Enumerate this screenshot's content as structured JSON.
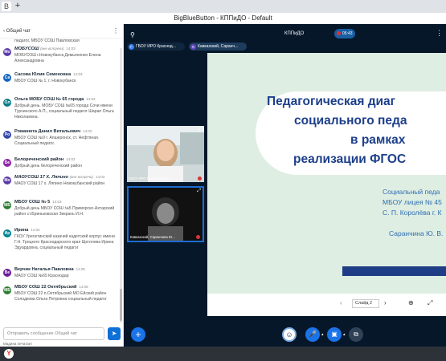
{
  "browser": {
    "tab_icon": "B",
    "new_tab": "+",
    "window_title": "BigBlueButton - КППиДО - Default"
  },
  "chat": {
    "back": "‹",
    "title": "Общий чат",
    "more": "⋮",
    "first_line": "педагог, МБОУ СОШ Павловская",
    "composer_placeholder": "Отправить сообщение Общий чат",
    "send": "➤",
    "typing": "Мадина печатает",
    "messages": [
      {
        "initials": "Мо",
        "color": "#5b3aa8",
        "name": "МОБУСОШ",
        "status": "(вне встречи)",
        "time": "14:03",
        "text": "МОБУСОШ г.Новокубанск,Демьяненко Елена Александровна",
        "italic": true
      },
      {
        "initials": "Са",
        "color": "#1565c0",
        "name": "Сасова Юлия Семеновна",
        "status": "",
        "time": "14:03",
        "text": "МБОУ СОШ № 1, г. Новокубанск",
        "italic": false
      },
      {
        "initials": "Ол",
        "color": "#0d7d8a",
        "name": "Ольга МОБУ СОШ № 65 города",
        "status": "",
        "time": "14:03",
        "text": "Добрый день. МОБУ СОШ №65 города Сочи имени Турчинского А.П., социальный педагог Шарап Ольга Николаевна.",
        "italic": false
      },
      {
        "initials": "Ро",
        "color": "#3949ab",
        "name": "Романюта Данил Витальевич",
        "status": "",
        "time": "14:02",
        "text": "МБОУ СОШ №9 г. Апшеронск, ст. Нефтяная. Социальный педагог.",
        "italic": false
      },
      {
        "initials": "Бе",
        "color": "#8e24aa",
        "name": "Белореченский район",
        "status": "",
        "time": "14:02",
        "text": "Добрый день белореченский район",
        "italic": false
      },
      {
        "initials": "Мо",
        "color": "#5b3aa8",
        "name": "МАОУСОШ 17 Х. Ляпино",
        "status": "(вне встречи)",
        "time": "14:03",
        "text": "МАОУ СОШ 17 х. Ляпино Новокубанский район",
        "italic": true
      },
      {
        "initials": "МБ",
        "color": "#2e7d32",
        "name": "МБОУ СОШ № 5",
        "status": "",
        "time": "14:03",
        "text": "Добрый день МБОУ СОШ №5 Приморско-Ахтарский район ст.Бриньковская Зикрань И.Н.",
        "italic": false
      },
      {
        "initials": "Ир",
        "color": "#00838f",
        "name": "Ирина",
        "status": "",
        "time": "14:04",
        "text": "ГКОУ Уреохтинский казачий кадетский корпус имени Г.Н. Троцкого Краснодарского края Щеголева Ирина Эдуардовна, социальный педагог",
        "italic": false
      },
      {
        "initials": "Ве",
        "color": "#6a1b9a",
        "name": "Верчик Наталья Павловна",
        "status": "",
        "time": "14:05",
        "text": "МАОУ СОШ №65 Краснодар",
        "italic": false
      },
      {
        "initials": "МБ",
        "color": "#2e7d32",
        "name": "МБОУ СОШ 22 Октябрьский",
        "status": "",
        "time": "14:05",
        "text": "МБОУ СОШ 22 п.Октябрьский МО Ейский район Солодкова Ольга Петровна социальный педагог",
        "italic": false
      }
    ]
  },
  "main": {
    "user_icon": "⚲",
    "presentation_title": "КППиДО",
    "recording_time": "05:43",
    "more": "⋮",
    "chip1": "ГБОУ ИРО Краснод...",
    "chip2": "Кавказский, Саранч...",
    "chip1_icon": "Г",
    "chip2_icon": "К",
    "video1_label": "ГБОУ ИРО Краснодарско...",
    "video2_label": "Кавказский, Саранчина Ю...",
    "slide": {
      "line1": "Педагогическая диаг",
      "line2": "социального педа",
      "line3": "в рамках",
      "line4": "реализации ФГОС",
      "sub1": "Социальный педа",
      "sub2": "МБОУ лицея № 45",
      "sub3": "С. П. Королёва г. К",
      "sub4": "Саранчина Ю. В."
    },
    "slide_select": "Слайд 2",
    "controls": {
      "plus": "+",
      "react": "☺",
      "audio": "🎤",
      "video": "▣",
      "screen": "⧉"
    }
  },
  "taskbar": {
    "browser_icon": "Y"
  }
}
